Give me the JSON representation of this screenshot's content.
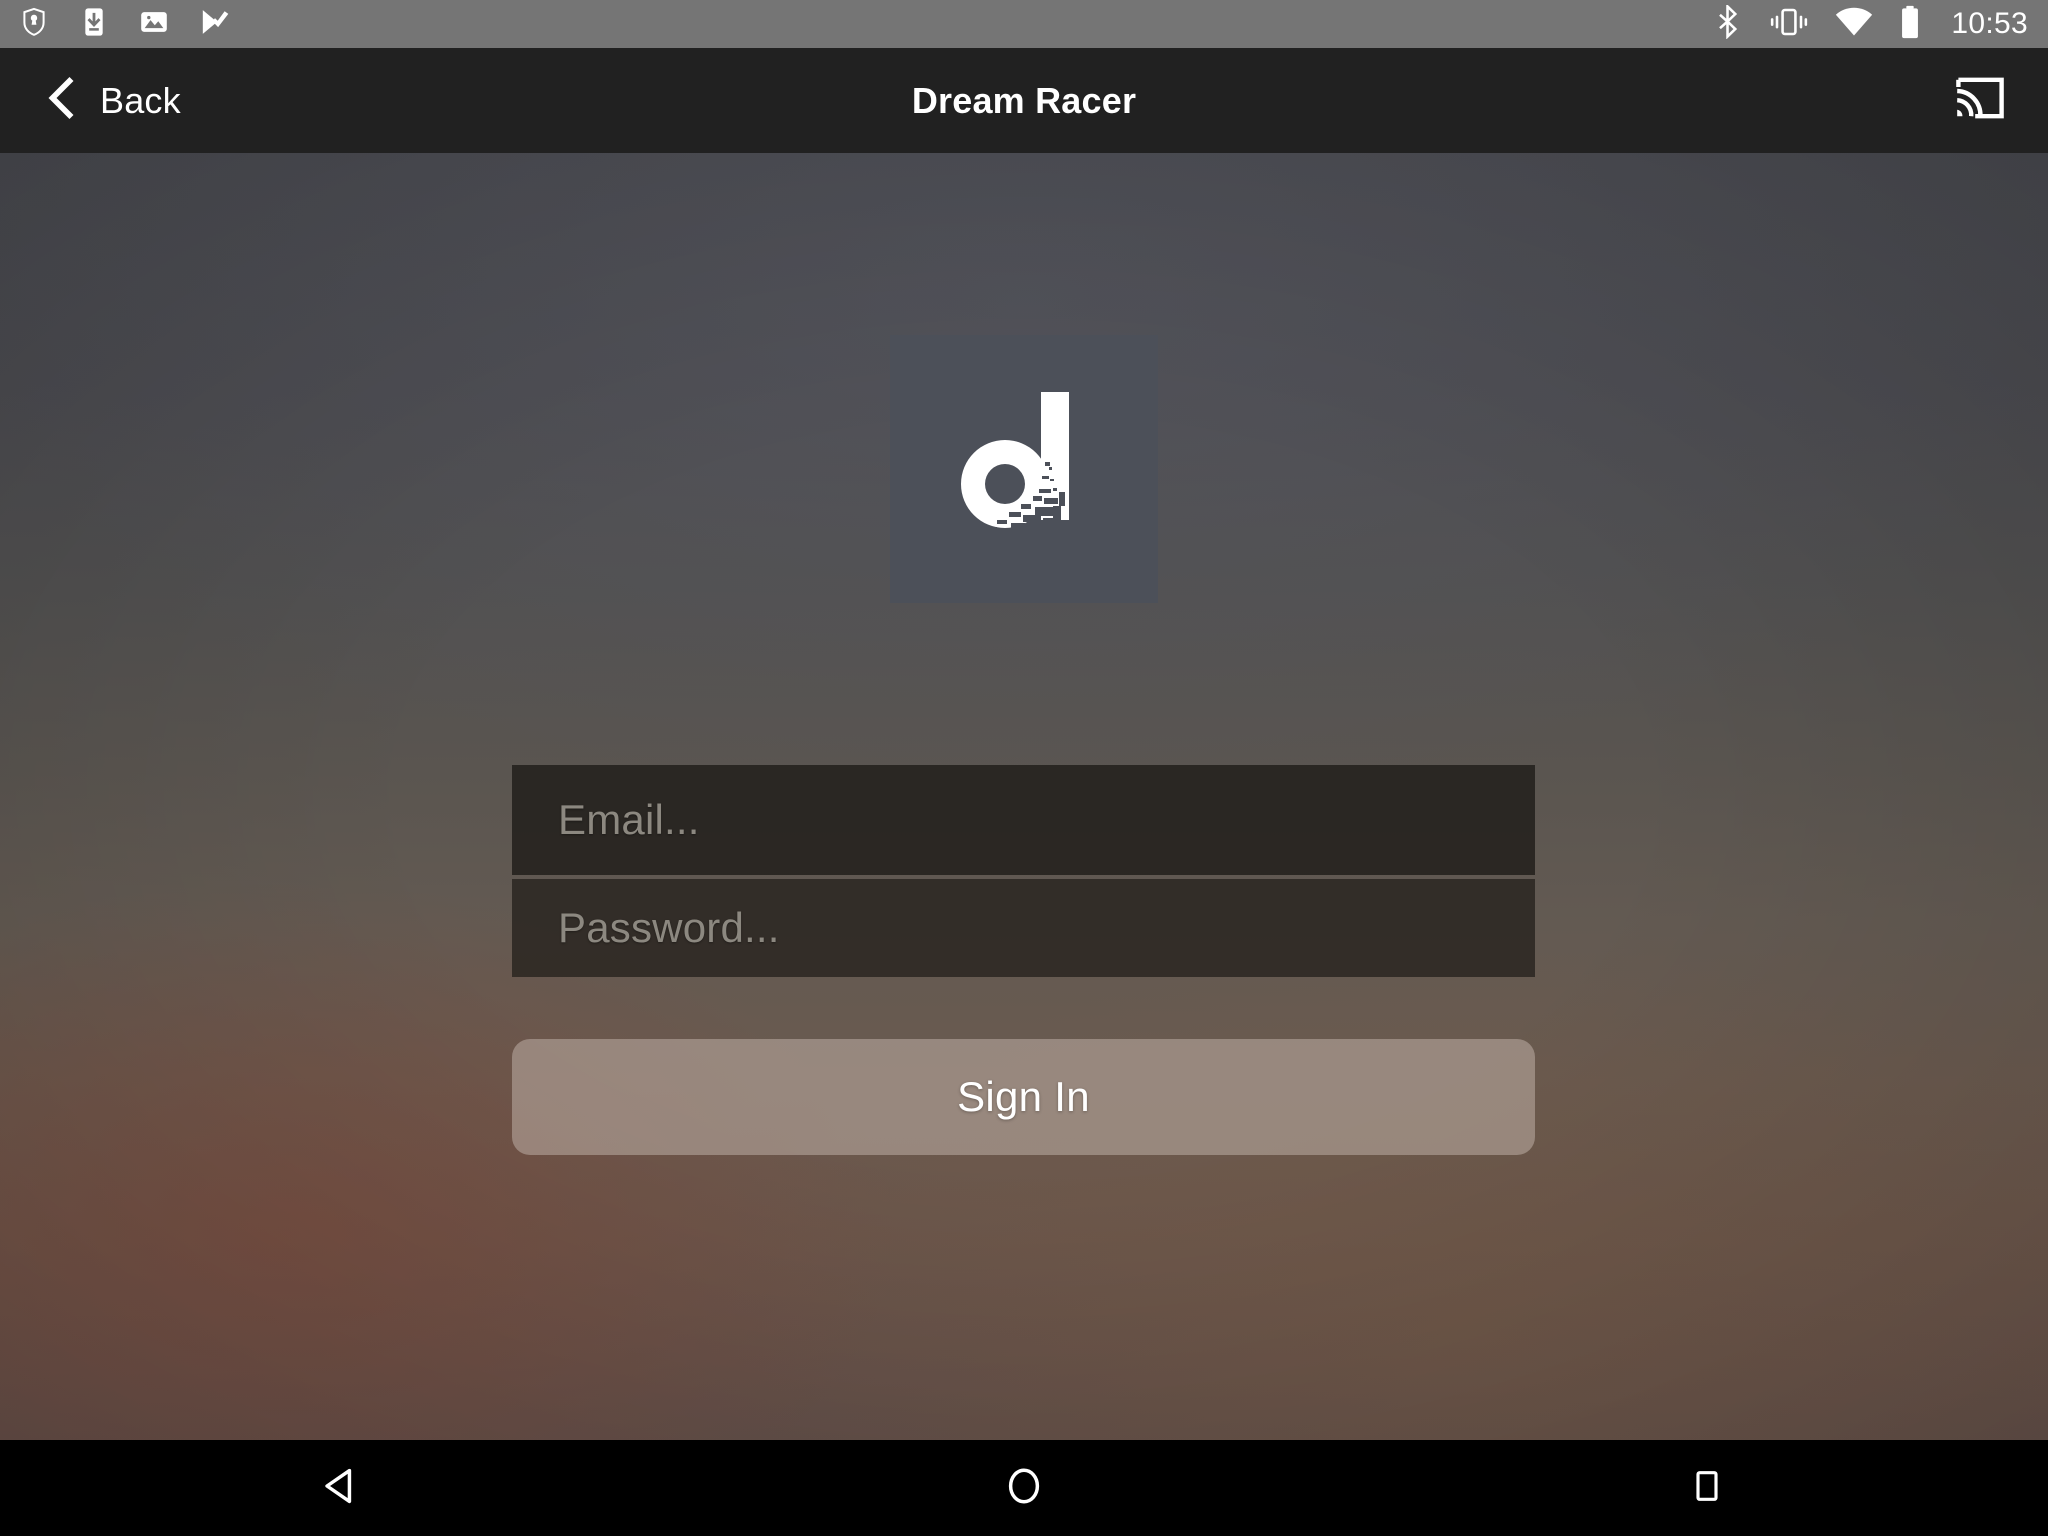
{
  "status_bar": {
    "background": "#757575",
    "left_icons": [
      {
        "name": "brave-shield-icon",
        "label": "Brave"
      },
      {
        "name": "download-to-device-icon",
        "label": "Download"
      },
      {
        "name": "image-gallery-icon",
        "label": "Screenshot"
      },
      {
        "name": "checkmark-play-icon",
        "label": "Tasks"
      }
    ],
    "right_icons": [
      {
        "name": "bluetooth-icon",
        "label": "Bluetooth"
      },
      {
        "name": "vibrate-icon",
        "label": "Vibrate"
      },
      {
        "name": "wifi-icon",
        "label": "Wi-Fi"
      },
      {
        "name": "battery-icon",
        "label": "Battery"
      }
    ],
    "clock": "10:53"
  },
  "app_bar": {
    "background": "#212121",
    "back_label": "Back",
    "back_icon": "chevron-left-icon",
    "title": "Dream Racer",
    "cast_icon": "chromecast-icon"
  },
  "content": {
    "logo": {
      "name": "dream-racer-logo",
      "letter": "d",
      "tile_color": "#4c5059",
      "glyph_color": "#ffffff"
    },
    "backdrop": {
      "top_color": "#494a50",
      "bottom_color": "#63504a"
    }
  },
  "form": {
    "email": {
      "name": "email-input",
      "placeholder": "Email...",
      "value": ""
    },
    "password": {
      "name": "password-input",
      "placeholder": "Password...",
      "value": ""
    },
    "submit": {
      "label": "Sign In",
      "background": "#beafa5"
    }
  },
  "nav_bar": {
    "background": "#000000",
    "buttons": [
      {
        "name": "android-back-button",
        "icon": "triangle-left-icon",
        "label": "Back"
      },
      {
        "name": "android-home-button",
        "icon": "circle-icon",
        "label": "Home"
      },
      {
        "name": "android-recents-button",
        "icon": "square-icon",
        "label": "Recents"
      }
    ]
  }
}
